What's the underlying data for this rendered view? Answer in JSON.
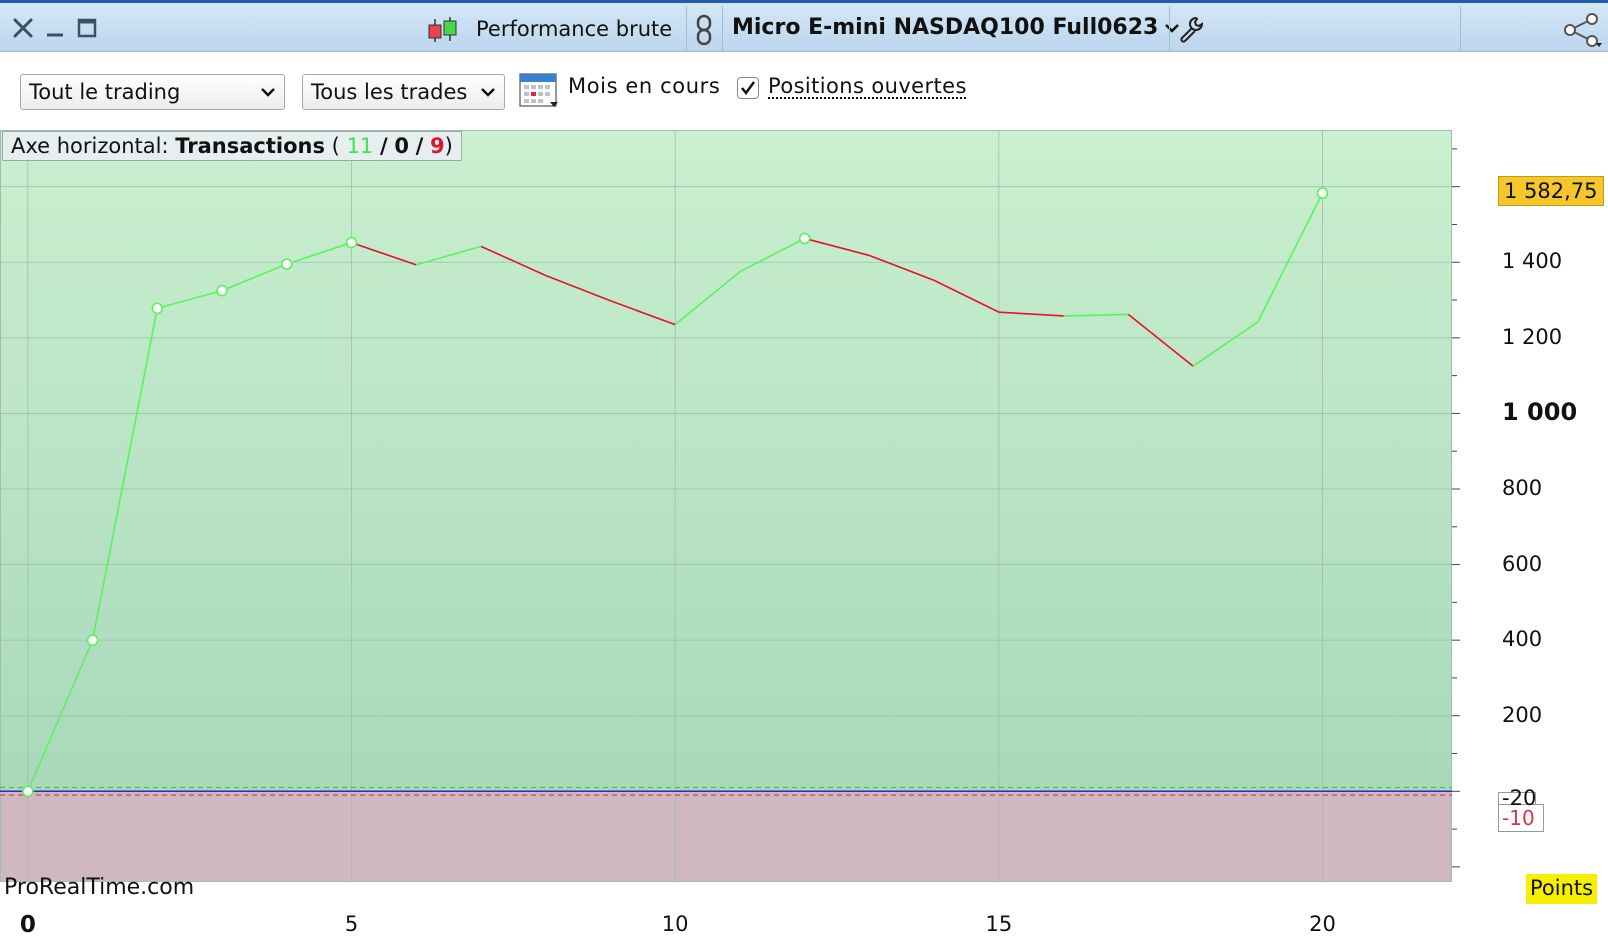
{
  "window": {
    "title": "Performance brute",
    "instrument": "Micro E-mini NASDAQ100 Full0623"
  },
  "toolbar": {
    "scope_select": "Tout le trading",
    "trades_select": "Tous les trades",
    "period_label": "Mois en cours",
    "open_positions_label": "Positions ouvertes",
    "open_positions_checked": true
  },
  "chart_header": {
    "axis_prefix": "Axe horizontal:",
    "axis_mode": "Transactions",
    "open_paren": "(",
    "winners": "11",
    "slash1": "/",
    "neutral": "0",
    "slash2": "/",
    "losers": "9",
    "close_paren": ")"
  },
  "branding": {
    "watermark": "ProRealTime.com"
  },
  "colors": {
    "up_line": "#5df25d",
    "down_line": "#e8102a",
    "positive_fill_top": "#c9f0cf",
    "positive_fill_bottom": "#a9d8bb",
    "negative_fill": "#cfb8c0",
    "last_value_bg": "#f5c72b",
    "zero_line": "#2a2ad0"
  },
  "chart_data": {
    "type": "line",
    "x": [
      0,
      1,
      2,
      3,
      4,
      5,
      6,
      7,
      8,
      9,
      10,
      11,
      12,
      13,
      14,
      15,
      16,
      17,
      18,
      19,
      20
    ],
    "values": [
      0,
      400,
      1278,
      1325,
      1395,
      1452,
      1393,
      1442,
      1365,
      1298,
      1235,
      1375,
      1463,
      1418,
      1352,
      1268,
      1258,
      1262,
      1125,
      1242,
      1582.75
    ],
    "markers": [
      0,
      1,
      2,
      3,
      4,
      5,
      12,
      20
    ],
    "last_value_label": "1 582,75",
    "negative_label": "-10",
    "unit_label": "Points",
    "y_ticks": [
      {
        "value": 1400,
        "label": "1 400",
        "bold": false
      },
      {
        "value": 1200,
        "label": "1 200",
        "bold": false
      },
      {
        "value": 1000,
        "label": "1 000",
        "bold": true
      },
      {
        "value": 800,
        "label": "800",
        "bold": false
      },
      {
        "value": 600,
        "label": "600",
        "bold": false
      },
      {
        "value": 400,
        "label": "400",
        "bold": false
      },
      {
        "value": 200,
        "label": "200",
        "bold": false
      },
      {
        "value": -20,
        "label": "-20",
        "bold": false
      }
    ],
    "x_ticks": [
      {
        "value": 0,
        "label": "0",
        "bold": true
      },
      {
        "value": 5,
        "label": "5",
        "bold": false
      },
      {
        "value": 10,
        "label": "10",
        "bold": false
      },
      {
        "value": 15,
        "label": "15",
        "bold": false
      },
      {
        "value": 20,
        "label": "20",
        "bold": false
      }
    ],
    "xlim": [
      -0.43,
      22
    ],
    "ylim": [
      -240,
      1750
    ],
    "grid": true
  }
}
